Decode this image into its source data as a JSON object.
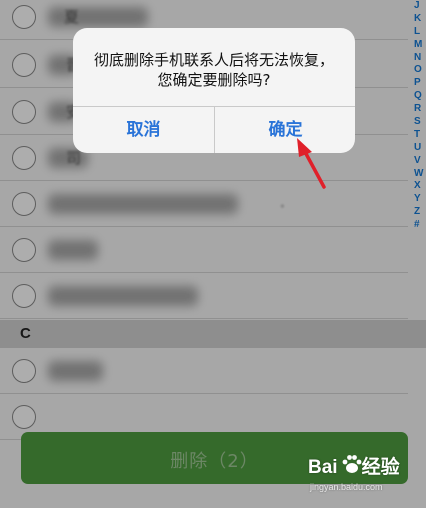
{
  "dialog": {
    "message": "彻底删除手机联系人后将无法恢复，您确定要删除吗?",
    "cancel_label": "取消",
    "confirm_label": "确定"
  },
  "contacts": {
    "visible_fragments": [
      "夏",
      "晋",
      "安",
      "司",
      "，",
      "."
    ],
    "section_letter": "C"
  },
  "index_letters": [
    "J",
    "K",
    "L",
    "M",
    "N",
    "O",
    "P",
    "Q",
    "R",
    "S",
    "T",
    "U",
    "V",
    "W",
    "X",
    "Y",
    "Z",
    "#"
  ],
  "delete_button": {
    "label": "删除（2）"
  },
  "watermark": {
    "logo_text": "Bai",
    "logo_suffix": "经验",
    "site": "jingyan.baidu.com"
  },
  "colors": {
    "accent_blue": "#2a74d8",
    "delete_green": "#4f9c40",
    "arrow_red": "#e0202a"
  }
}
